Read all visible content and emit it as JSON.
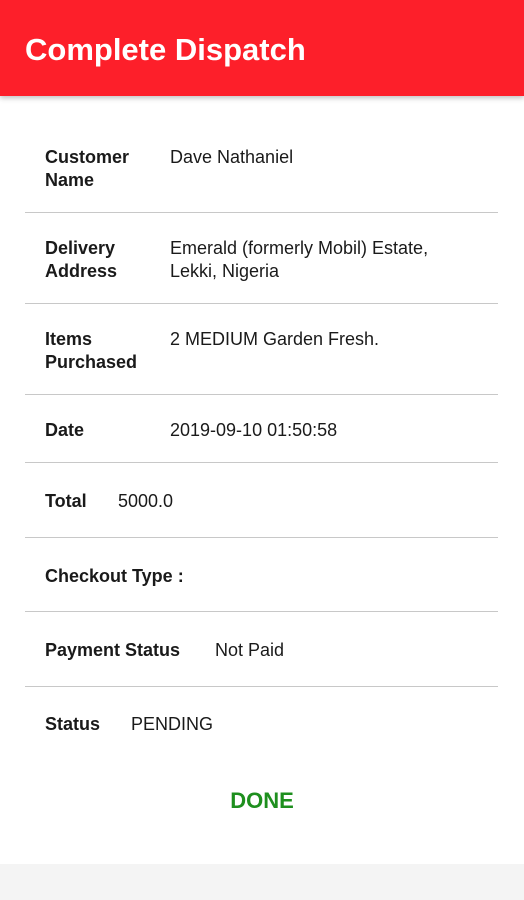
{
  "app_bar": {
    "title": "Complete Dispatch"
  },
  "details": [
    {
      "label_lines": [
        "Customer",
        "Name"
      ],
      "value_lines": [
        "Dave Nathaniel"
      ]
    },
    {
      "label_lines": [
        "Delivery",
        "Address"
      ],
      "value_lines": [
        "Emerald (formerly Mobil) Estate,",
        "Lekki, Nigeria"
      ]
    },
    {
      "label_lines": [
        "Items",
        "Purchased"
      ],
      "value_lines": [
        "2 MEDIUM Garden Fresh."
      ]
    },
    {
      "label": "Date",
      "value": "2019-09-10 01:50:58"
    },
    {
      "label": "Total",
      "value": "5000.0"
    },
    {
      "label": "Checkout Type :",
      "value": ""
    },
    {
      "label": "Payment Status",
      "value": "Not Paid"
    },
    {
      "label": "Status",
      "value": "PENDING"
    }
  ],
  "actions": {
    "done_label": "DONE"
  },
  "colors": {
    "app_bar": "#fd1f2a",
    "done": "#1e8f1e",
    "divider": "#c8c8c8"
  }
}
